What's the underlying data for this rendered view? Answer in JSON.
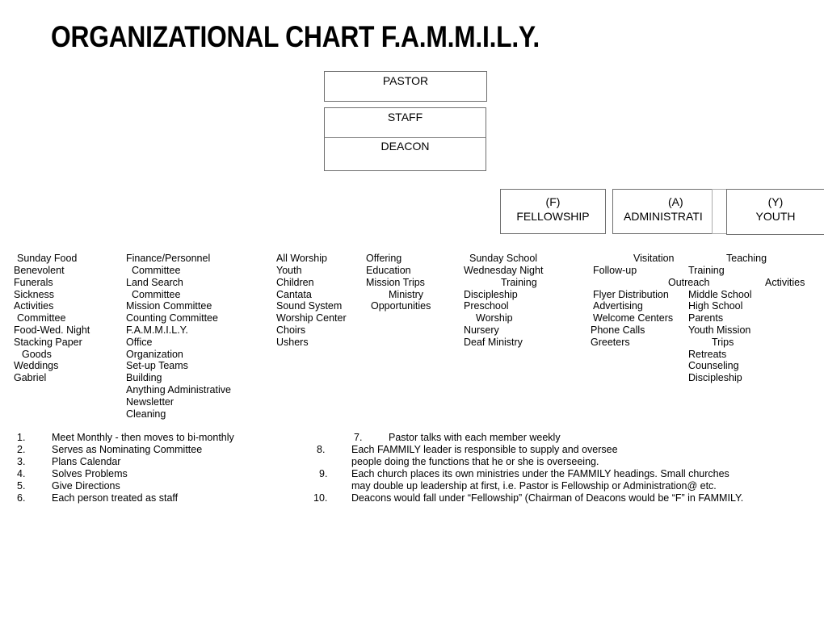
{
  "title": "ORGANIZATIONAL CHART F.A.M.M.I.L.Y.",
  "leadership_boxes": {
    "pastor": "PASTOR",
    "staff": "STAFF",
    "deacon": "DEACON"
  },
  "famm_headings": [
    {
      "letter": "(F)",
      "label": "FELLOWSHIP"
    },
    {
      "letter": "(A)",
      "label": "ADMINISTRATI"
    },
    {
      "letter": "",
      "label": ""
    },
    {
      "letter": "(Y)",
      "label": "YOUTH"
    }
  ],
  "columns": {
    "fellowship": [
      "Sunday Food",
      "Benevolent",
      "Funerals",
      "Sickness",
      "Activities",
      "Committee",
      "Food-Wed. Night",
      "Stacking Paper",
      "Goods",
      "Weddings",
      "Gabriel"
    ],
    "administration": [
      "Finance/Personnel",
      "Committee",
      "Land Search",
      "Committee",
      "Mission Committee",
      "Counting Committee",
      "F.A.M.M.I.L.Y.",
      "Office",
      "Organization",
      "Set-up Teams",
      "Building",
      "Anything Administrative",
      "Newsletter",
      "Cleaning"
    ],
    "music": [
      "All Worship",
      "Youth",
      "Children",
      "Cantata",
      "Sound System",
      "Worship Center",
      "Choirs",
      "Ushers"
    ],
    "missions": [
      "Offering",
      "Education",
      "Mission Trips",
      "Ministry",
      "Opportunities"
    ],
    "education": [
      "Sunday School",
      "Wednesday Night",
      "Training",
      "Discipleship",
      "Preschool",
      "Worship",
      "Nursery",
      "Deaf Ministry"
    ],
    "outreach_headers": {
      "visitation": "Visitation",
      "teaching": "Teaching",
      "training": "Training",
      "outreach": "Outreach",
      "activities": "Activities"
    },
    "outreach": [
      "Follow-up",
      "Flyer Distribution",
      "Advertising",
      "Welcome Centers",
      "Phone Calls",
      "Greeters"
    ],
    "youth": [
      "Middle School",
      "High School",
      "Parents",
      "Youth Mission",
      "Trips",
      "Retreats",
      "Counseling",
      "Discipleship"
    ]
  },
  "notes_left": [
    {
      "num": "1.",
      "text": "Meet Monthly - then moves to bi-monthly"
    },
    {
      "num": "2.",
      "text": "Serves as Nominating Committee"
    },
    {
      "num": "3.",
      "text": "Plans Calendar"
    },
    {
      "num": "4.",
      "text": "Solves Problems"
    },
    {
      "num": "5.",
      "text": "Give Directions"
    },
    {
      "num": "6.",
      "text": "Each person treated as staff"
    }
  ],
  "notes_right": [
    {
      "num": "7.",
      "text": "Pastor talks with each member weekly"
    },
    {
      "num": "8.",
      "text": "Each FAMMILY leader is responsible to supply and oversee"
    },
    {
      "num": "",
      "text": "people doing the functions that he or she is overseeing."
    },
    {
      "num": "9.",
      "text": "Each church places its own ministries under the FAMMILY headings.   Small churches"
    },
    {
      "num": "",
      "text": "may double up leadership at first, i.e. Pastor is Fellowship or Administration@ etc."
    },
    {
      "num": "10.",
      "text": "Deacons would fall under “Fellowship” (Chairman of Deacons would be “F” in FAMMILY."
    }
  ]
}
